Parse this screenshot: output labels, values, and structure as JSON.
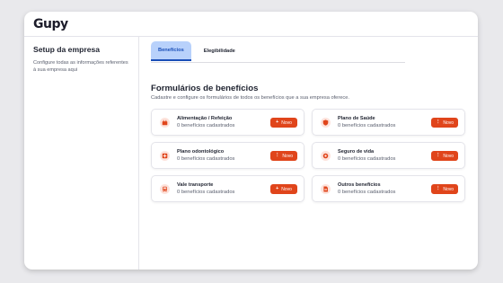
{
  "brand": {
    "logo_text": "Gupy"
  },
  "sidebar": {
    "title": "Setup da empresa",
    "description": "Configure todas as informações referentes à sua empresa aqui"
  },
  "tabs": [
    {
      "label": "Benefícios",
      "active": true
    },
    {
      "label": "Elegibilidade",
      "active": false
    }
  ],
  "section": {
    "title": "Formulários de benefícios",
    "subtitle": "Cadastre e configure os formulários de todos os benefícios que a sua empresa oferece."
  },
  "benefits": [
    {
      "title": "Alimentação / Refeição",
      "count": "0 benefícios cadastrados",
      "icon": "food-icon",
      "button_glyph": "+",
      "button_label": "Novo"
    },
    {
      "title": "Plano de Saúde",
      "count": "0 benefícios cadastrados",
      "icon": "shield-icon",
      "button_glyph": "⋮",
      "button_label": "Novo"
    },
    {
      "title": "Plano odontológico",
      "count": "0 benefícios cadastrados",
      "icon": "medical-cross-icon",
      "button_glyph": "⋮",
      "button_label": "Novo"
    },
    {
      "title": "Seguro de vida",
      "count": "0 benefícios cadastrados",
      "icon": "life-buoy-icon",
      "button_glyph": "⋮",
      "button_label": "Novo"
    },
    {
      "title": "Vale transporte",
      "count": "0 benefícios cadastrados",
      "icon": "bus-icon",
      "button_glyph": "+",
      "button_label": "Novo"
    },
    {
      "title": "Outros benefícios",
      "count": "0 benefícios cadastrados",
      "icon": "document-icon",
      "button_glyph": "⋮",
      "button_label": "Novo"
    }
  ],
  "colors": {
    "accent": "#e0451b",
    "icon_bg": "#fde3dc",
    "tab_active_bg": "#b8d1fb",
    "tab_active_text": "#1a4fb8"
  }
}
